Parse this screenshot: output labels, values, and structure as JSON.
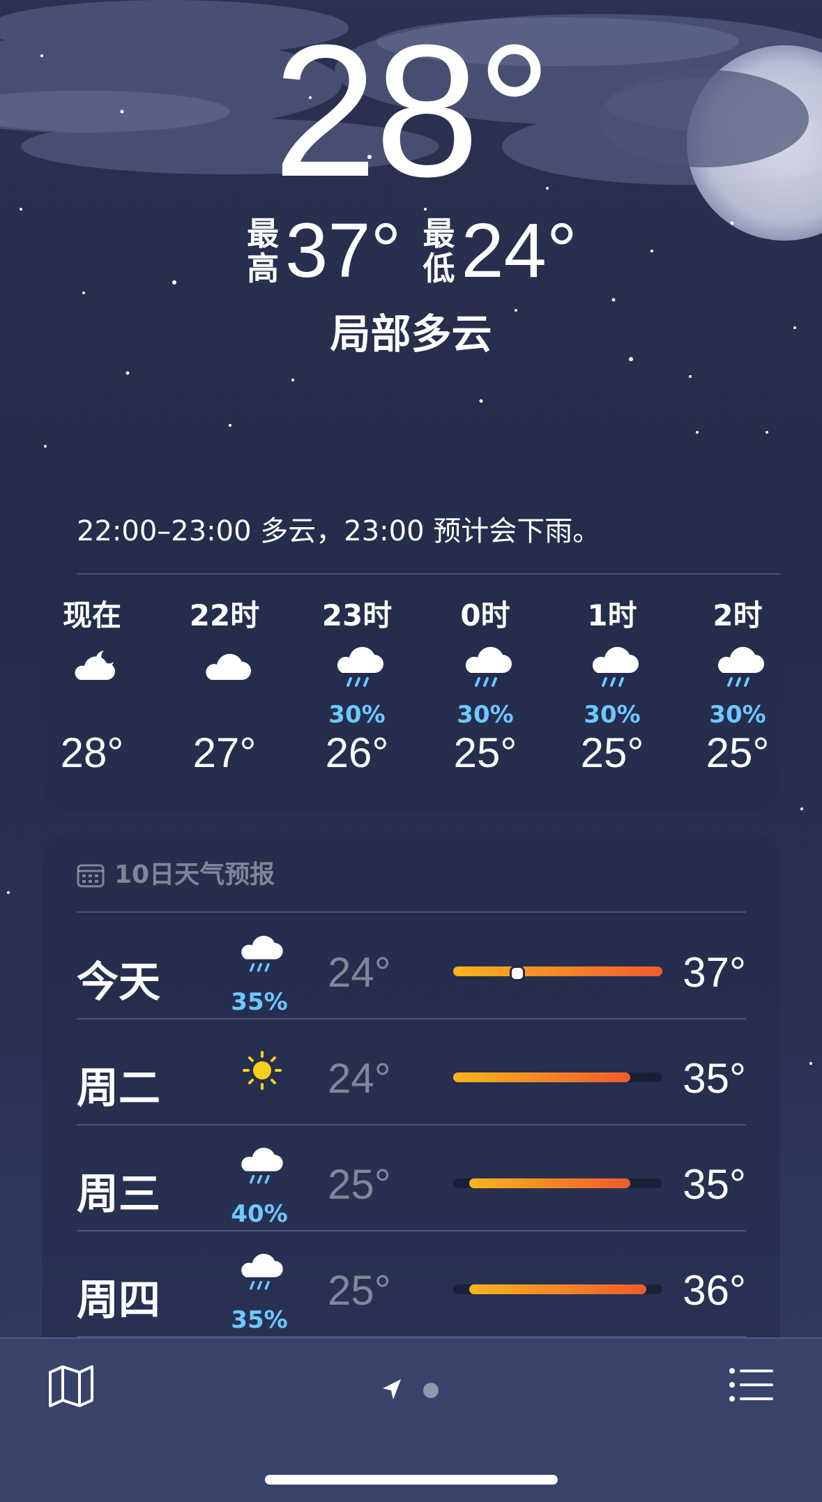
{
  "current": {
    "temperature": "28°",
    "high_label": "最高",
    "high": "37°",
    "low_label": "最低",
    "low": "24°",
    "condition": "局部多云"
  },
  "hourly": {
    "summary": "22:00–23:00 多云，23:00 预计会下雨。",
    "items": [
      {
        "label": "现在",
        "icon": "cloud-moon-icon",
        "precip": "",
        "temp": "28°"
      },
      {
        "label": "22时",
        "icon": "cloud-icon",
        "precip": "",
        "temp": "27°"
      },
      {
        "label": "23时",
        "icon": "cloud-rain-icon",
        "precip": "30%",
        "temp": "26°"
      },
      {
        "label": "0时",
        "icon": "cloud-rain-icon",
        "precip": "30%",
        "temp": "25°"
      },
      {
        "label": "1时",
        "icon": "cloud-rain-icon",
        "precip": "30%",
        "temp": "25°"
      },
      {
        "label": "2时",
        "icon": "cloud-rain-icon",
        "precip": "30%",
        "temp": "25°"
      }
    ]
  },
  "daily": {
    "title": "10日天气预报",
    "range_min": 24,
    "range_max": 37,
    "rows": [
      {
        "day": "今天",
        "icon": "cloud-rain-icon",
        "precip": "35%",
        "low": "24°",
        "high": "37°",
        "low_value": 24,
        "high_value": 37,
        "current_value": 28
      },
      {
        "day": "周二",
        "icon": "sun-icon",
        "precip": "",
        "low": "24°",
        "high": "35°",
        "low_value": 24,
        "high_value": 35
      },
      {
        "day": "周三",
        "icon": "cloud-rain-icon",
        "precip": "40%",
        "low": "25°",
        "high": "35°",
        "low_value": 25,
        "high_value": 35
      },
      {
        "day": "周四",
        "icon": "cloud-rain-icon",
        "precip": "35%",
        "low": "25°",
        "high": "36°",
        "low_value": 25,
        "high_value": 36
      }
    ]
  },
  "colors": {
    "precip": "#6ec8ff",
    "bar_start": "#f7b51c",
    "bar_end": "#f25a2d",
    "sun": "#f9cf1d"
  },
  "tabbar": {
    "map_icon": "map-icon",
    "location_icon": "location-arrow-icon",
    "list_icon": "list-icon"
  }
}
